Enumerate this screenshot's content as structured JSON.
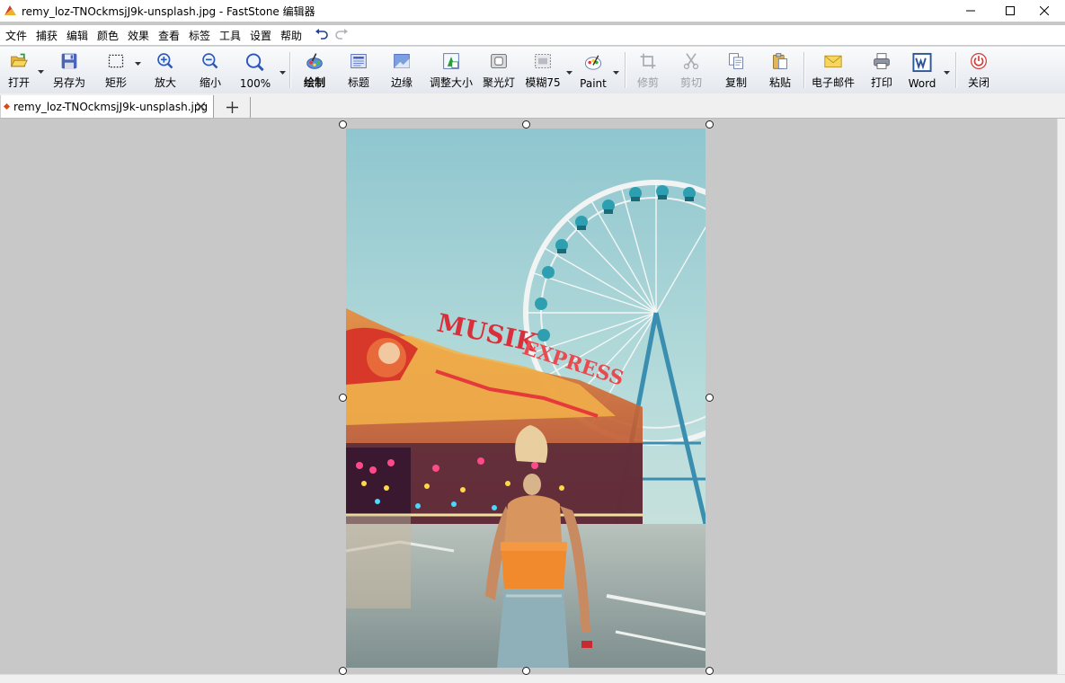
{
  "window": {
    "title": "remy_loz-TNOckmsjJ9k-unsplash.jpg - FastStone 编辑器",
    "controls": [
      "minimize-icon",
      "maximize-icon",
      "close-icon"
    ]
  },
  "menu": {
    "items": [
      "文件",
      "捕获",
      "编辑",
      "颜色",
      "效果",
      "查看",
      "标签",
      "工具",
      "设置",
      "帮助"
    ],
    "undo_icon": "undo-icon",
    "redo_icon": "redo-icon"
  },
  "toolbar": {
    "open": "打开",
    "save_as": "另存为",
    "rectangle": "矩形",
    "zoom_in": "放大",
    "zoom_out": "缩小",
    "zoom_level": "100%",
    "draw": "绘制",
    "caption": "标题",
    "edge": "边缘",
    "resize": "调整大小",
    "spotlight": "聚光灯",
    "blur": "模糊75",
    "paint": "Paint",
    "crop": "修剪",
    "cut": "剪切",
    "copy": "复制",
    "paste": "粘贴",
    "email": "电子邮件",
    "print": "打印",
    "word": "Word",
    "close": "关闭"
  },
  "tabs": {
    "active_file": "remy_loz-TNOckmsjJ9k-unsplash.jpg",
    "new_tab": "+"
  },
  "image": {
    "subject": "woman in orange top and denim shorts facing a ferris wheel at a funfair",
    "sign_text": "MUSIK EXPRESS"
  },
  "colors": {
    "sky": "#9fcfd6",
    "accent_orange": "#f08a2c",
    "canvas_bg": "#c8c8c8",
    "toolbar_top": "#fafbfc",
    "toolbar_bottom": "#e4e8ee"
  }
}
